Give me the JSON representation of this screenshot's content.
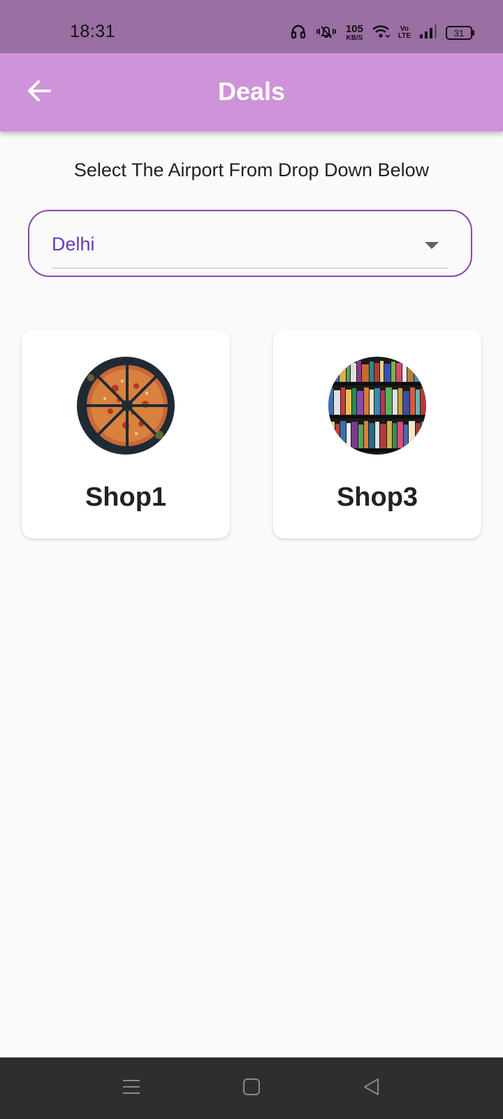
{
  "status_bar": {
    "time": "18:31",
    "network_speed_value": "105",
    "network_speed_unit": "KB/S",
    "volte_top": "Vo",
    "volte_bottom": "LTE",
    "battery_level": "31",
    "icons": [
      "headphones-icon",
      "vibrate-mute-icon",
      "wifi-icon",
      "signal-icon",
      "battery-icon"
    ]
  },
  "app_bar": {
    "title": "Deals",
    "back_icon": "arrow-back-icon",
    "background": "#ce93d8"
  },
  "main": {
    "instruction": "Select The Airport From Drop Down Below",
    "dropdown": {
      "selected": "Delhi",
      "icon": "dropdown-arrow-icon",
      "border_color": "#8e44ad",
      "text_color": "#673ab7"
    },
    "shops": [
      {
        "name": "Shop1",
        "image": "pizza-image"
      },
      {
        "name": "Shop3",
        "image": "bookshelf-image"
      }
    ]
  },
  "nav_bar": {
    "buttons": [
      "menu-icon",
      "home-icon",
      "back-triangle-icon"
    ]
  }
}
